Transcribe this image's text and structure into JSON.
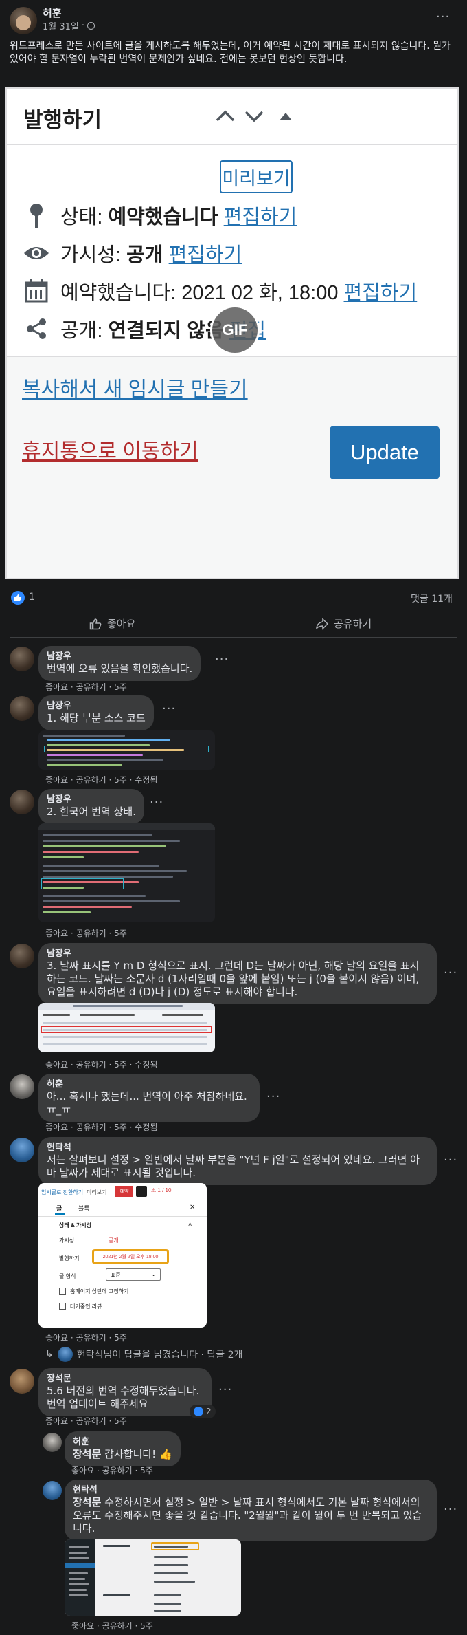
{
  "post": {
    "author": "허훈",
    "date": "1월 31일",
    "date_suffix": "·",
    "more": "···",
    "text": "워드프레스로 만든 사이트에 글을 게시하도록 해두었는데, 이거 예약된 시간이 제대로 표시되지 않습니다. 뭔가 있어야 할 문자열이 누락된 번역이 문제인가 싶네요. 전에는 못보던 현상인 듯합니다."
  },
  "wp_panel": {
    "title": "발행하기",
    "preview_button": "미리보기",
    "status_label": "상태: ",
    "status_value": "예약했습니다",
    "status_edit": "편집하기",
    "visibility_label": "가시성: ",
    "visibility_value": "공개",
    "visibility_edit": "편집하기",
    "schedule_text": "예약했습니다: 2021 02 화, 18:00",
    "schedule_edit": "편집하기",
    "share_label": "공개: ",
    "share_value": "연결되지 않음",
    "share_edit": "편집",
    "copy_link": "복사해서 새 임시글 만들기",
    "trash_link": "휴지통으로 이동하기",
    "update_button": "Update",
    "gif_badge": "GIF"
  },
  "stats": {
    "like_count": "1",
    "comment_count": "댓글 11개"
  },
  "actions": {
    "like": "좋아요",
    "share": "공유하기"
  },
  "comments": [
    {
      "name": "남장우",
      "text": "번역에 오류 있음을 확인했습니다.",
      "actions": "좋아요 · 공유하기 · 5주"
    },
    {
      "name": "남장우",
      "text": "1. 해당 부분 소스 코드",
      "actions": "좋아요 · 공유하기 · 5주 · 수정됨"
    },
    {
      "name": "남장우",
      "text": "2. 한국어 번역 상태.",
      "actions": "좋아요 · 공유하기 · 5주"
    },
    {
      "name": "남장우",
      "text": "3. 날짜 표시를 Y m D 형식으로 표시. 그런데 D는 날짜가 아닌, 해당 날의 요일을 표시하는 코드. 날짜는 소문자 d (1자리일때 0을 앞에 붙임) 또는 j (0을 붙이지 않음) 이며, 요일을 표시하려면 d (D)나 j (D) 정도로 표시해야 합니다.",
      "actions": "좋아요 · 공유하기 · 5주 · 수정됨"
    },
    {
      "name": "허훈",
      "text": "아... 혹시나 했는데... 번역이 아주 처참하네요. ㅠ_ㅠ",
      "actions": "좋아요 · 공유하기 · 5주 · 수정됨"
    },
    {
      "name": "현탁석",
      "text": "저는 살펴보니 설정 > 일반에서 날짜 부분을 \"Y년 F j일\"로 설정되어 있네요. 그러면 아마 날짜가 제대로 표시될 것입니다.",
      "actions": "좋아요 · 공유하기 · 5주"
    },
    {
      "name": "장석문",
      "text": "5.6 버전의 번역 수정해두었습니다. 번역 업데이트 해주세요",
      "actions": "좋아요 · 공유하기 · 5주",
      "reactions": "2"
    }
  ],
  "replies_summary": "현탁석님이 답글을 남겼습니다 · 답글 2개",
  "replies": [
    {
      "name": "허훈",
      "mention": "장석문",
      "text": " 감사합니다! 👍",
      "actions": "좋아요 · 공유하기 · 5주"
    },
    {
      "name": "현탁석",
      "mention": "장석문",
      "text": " 수정하시면서 설정 > 일반 > 날짜 표시 형식에서도 기본 날짜 형식에서의 오류도 수정해주시면 좋을 것 같습니다. \"2월월\"과 같이 월이 두 번 반복되고 있습니다.",
      "actions": "좋아요 · 공유하기 · 5주"
    }
  ],
  "settings_screenshot": {
    "tabs": [
      "임시글로 전환하기",
      "미리보기",
      "예약"
    ],
    "tab_post": "글",
    "tab_block": "블록",
    "section": "상태 & 가시성",
    "visibility_label": "가시성",
    "visibility_value": "공개",
    "publish_label": "발행하기",
    "publish_value": "2021년 2월 2일 오후 18:00",
    "format_label": "글 형식",
    "format_value": "표준",
    "sticky": "홈페이지 상단에 고정하기",
    "pending": "대기중인 리뷰"
  },
  "colors": {
    "bg": "#18191a",
    "bubble": "#3a3b3c",
    "wp_blue": "#2271b1",
    "wp_red": "#b32d2e",
    "fb_blue": "#2d88ff"
  }
}
